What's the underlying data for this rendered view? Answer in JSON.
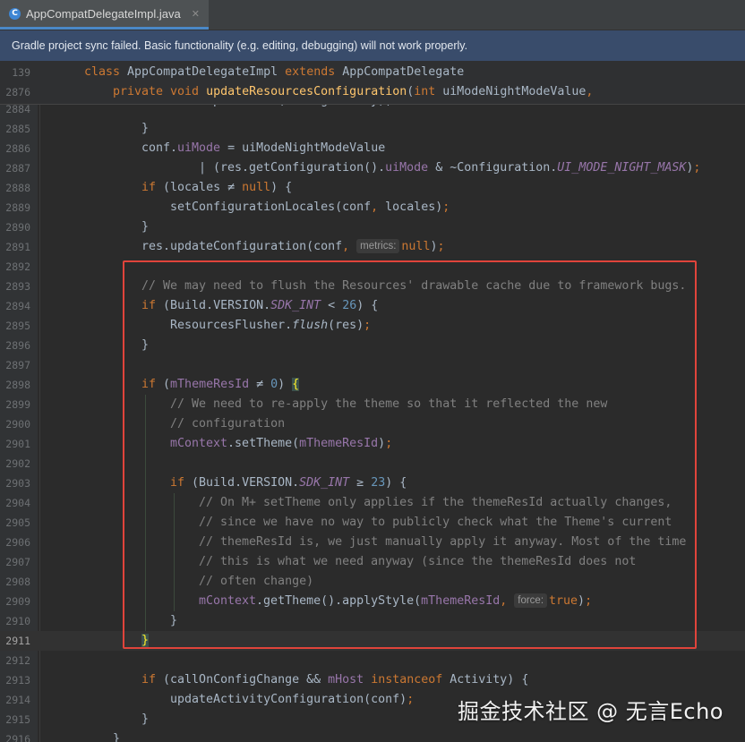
{
  "tab": {
    "icon": "C",
    "title": "AppCompatDelegateImpl.java",
    "close": "✕"
  },
  "banner": {
    "message": "Gradle project sync failed. Basic functionality (e.g. editing, debugging) will not work properly."
  },
  "sticky": [
    {
      "n": "139",
      "indent": 1,
      "t": [
        [
          "kw",
          "class "
        ],
        [
          "",
          "AppCompatDelegateImpl "
        ],
        [
          "kw",
          "extends "
        ],
        [
          "",
          "AppCompatDelegate"
        ]
      ]
    },
    {
      "n": "2876",
      "indent": 2,
      "t": [
        [
          "kw",
          "private void "
        ],
        [
          "fn",
          "updateResourcesConfiguration"
        ],
        [
          "",
          "("
        ],
        [
          "kw",
          "int "
        ],
        [
          "",
          "uiModeNightModeValue"
        ],
        [
          "kw",
          ","
        ]
      ]
    }
  ],
  "lines": [
    {
      "n": "2884",
      "indent": 4,
      "partial": true,
      "t": [
        [
          "",
          "conf.updateFrom(configOverlay);"
        ]
      ]
    },
    {
      "n": "2885",
      "indent": 3,
      "t": [
        [
          "",
          "}"
        ]
      ]
    },
    {
      "n": "2886",
      "indent": 3,
      "t": [
        [
          "",
          "conf."
        ],
        [
          "fld",
          "uiMode"
        ],
        [
          "",
          " = uiModeNightModeValue"
        ]
      ]
    },
    {
      "n": "2887",
      "indent": 5,
      "t": [
        [
          "",
          "| (res.getConfiguration()."
        ],
        [
          "fld",
          "uiMode"
        ],
        [
          "",
          " & ~Configuration."
        ],
        [
          "sfld",
          "UI_MODE_NIGHT_MASK"
        ],
        [
          "",
          ")"
        ],
        [
          "kw",
          ";"
        ]
      ]
    },
    {
      "n": "2888",
      "indent": 3,
      "t": [
        [
          "kw",
          "if "
        ],
        [
          "",
          "(locales ≠ "
        ],
        [
          "kw",
          "null"
        ],
        [
          "",
          ") {"
        ]
      ]
    },
    {
      "n": "2889",
      "indent": 4,
      "t": [
        [
          "",
          "setConfigurationLocales(conf"
        ],
        [
          "kw",
          ", "
        ],
        [
          "",
          "locales)"
        ],
        [
          "kw",
          ";"
        ]
      ]
    },
    {
      "n": "2890",
      "indent": 3,
      "t": [
        [
          "",
          "}"
        ]
      ]
    },
    {
      "n": "2891",
      "indent": 3,
      "t": [
        [
          "",
          "res.updateConfiguration(conf"
        ],
        [
          "kw",
          ", "
        ],
        [
          "hint",
          "metrics:"
        ],
        [
          "kw",
          "null"
        ],
        [
          "",
          ")"
        ],
        [
          "kw",
          ";"
        ]
      ]
    },
    {
      "n": "2892",
      "indent": 0,
      "t": []
    },
    {
      "n": "2893",
      "indent": 3,
      "t": [
        [
          "cmt",
          "// We may need to flush the Resources' drawable cache due to framework bugs."
        ]
      ]
    },
    {
      "n": "2894",
      "indent": 3,
      "t": [
        [
          "kw",
          "if "
        ],
        [
          "",
          "(Build.VERSION."
        ],
        [
          "sfld",
          "SDK_INT"
        ],
        [
          "",
          " < "
        ],
        [
          "num",
          "26"
        ],
        [
          "",
          ") {"
        ]
      ]
    },
    {
      "n": "2895",
      "indent": 4,
      "t": [
        [
          "",
          "ResourcesFlusher."
        ],
        [
          "ital",
          "flush"
        ],
        [
          "",
          "(res)"
        ],
        [
          "kw",
          ";"
        ]
      ]
    },
    {
      "n": "2896",
      "indent": 3,
      "t": [
        [
          "",
          "}"
        ]
      ]
    },
    {
      "n": "2897",
      "indent": 0,
      "t": []
    },
    {
      "n": "2898",
      "indent": 3,
      "t": [
        [
          "kw",
          "if "
        ],
        [
          "",
          "("
        ],
        [
          "fld",
          "mThemeResId"
        ],
        [
          "",
          " ≠ "
        ],
        [
          "num",
          "0"
        ],
        [
          "",
          ") "
        ],
        [
          "brm",
          "{"
        ]
      ]
    },
    {
      "n": "2899",
      "indent": 4,
      "t": [
        [
          "cmt",
          "// We need to re-apply the theme so that it reflected the new"
        ]
      ]
    },
    {
      "n": "2900",
      "indent": 4,
      "t": [
        [
          "cmt",
          "// configuration"
        ]
      ]
    },
    {
      "n": "2901",
      "indent": 4,
      "t": [
        [
          "fld",
          "mContext"
        ],
        [
          "",
          ".setTheme("
        ],
        [
          "fld",
          "mThemeResId"
        ],
        [
          "",
          ")"
        ],
        [
          "kw",
          ";"
        ]
      ]
    },
    {
      "n": "2902",
      "indent": 0,
      "t": []
    },
    {
      "n": "2903",
      "indent": 4,
      "t": [
        [
          "kw",
          "if "
        ],
        [
          "",
          "(Build.VERSION."
        ],
        [
          "sfld",
          "SDK_INT"
        ],
        [
          "",
          " ≥ "
        ],
        [
          "num",
          "23"
        ],
        [
          "",
          ") {"
        ]
      ]
    },
    {
      "n": "2904",
      "indent": 5,
      "t": [
        [
          "cmt",
          "// On M+ setTheme only applies if the themeResId actually changes,"
        ]
      ]
    },
    {
      "n": "2905",
      "indent": 5,
      "t": [
        [
          "cmt",
          "// since we have no way to publicly check what the Theme's current"
        ]
      ]
    },
    {
      "n": "2906",
      "indent": 5,
      "t": [
        [
          "cmt",
          "// themeResId is, we just manually apply it anyway. Most of the time"
        ]
      ]
    },
    {
      "n": "2907",
      "indent": 5,
      "t": [
        [
          "cmt",
          "// this is what we need anyway (since the themeResId does not"
        ]
      ]
    },
    {
      "n": "2908",
      "indent": 5,
      "t": [
        [
          "cmt",
          "// often change)"
        ]
      ]
    },
    {
      "n": "2909",
      "indent": 5,
      "t": [
        [
          "fld",
          "mContext"
        ],
        [
          "",
          ".getTheme().applyStyle("
        ],
        [
          "fld",
          "mThemeResId"
        ],
        [
          "kw",
          ", "
        ],
        [
          "hint",
          "force:"
        ],
        [
          "kw",
          "true"
        ],
        [
          "",
          ")"
        ],
        [
          "kw",
          ";"
        ]
      ]
    },
    {
      "n": "2910",
      "indent": 4,
      "t": [
        [
          "",
          "}"
        ]
      ]
    },
    {
      "n": "2911",
      "indent": 3,
      "current": true,
      "t": [
        [
          "brm",
          "}"
        ]
      ]
    },
    {
      "n": "2912",
      "indent": 0,
      "t": []
    },
    {
      "n": "2913",
      "indent": 3,
      "t": [
        [
          "kw",
          "if "
        ],
        [
          "",
          "(callOnConfigChange && "
        ],
        [
          "fld",
          "mHost "
        ],
        [
          "kw",
          "instanceof "
        ],
        [
          "",
          "Activity) {"
        ]
      ]
    },
    {
      "n": "2914",
      "indent": 4,
      "t": [
        [
          "",
          "updateActivityConfiguration(conf)"
        ],
        [
          "kw",
          ";"
        ]
      ]
    },
    {
      "n": "2915",
      "indent": 3,
      "t": [
        [
          "",
          "}"
        ]
      ]
    },
    {
      "n": "2916",
      "indent": 2,
      "t": [
        [
          "",
          "}"
        ]
      ]
    }
  ],
  "watermark": {
    "text": "掘金技术社区 @ 无言Echo"
  },
  "colors": {
    "accent_tab": "#4a88c7",
    "banner_bg": "#394c6b",
    "highlight_box": "#e0443b",
    "editor_bg": "#2b2b2b"
  }
}
